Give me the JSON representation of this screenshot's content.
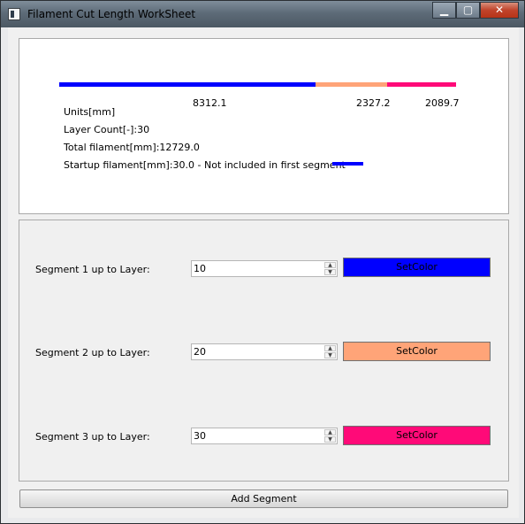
{
  "window": {
    "title": "Filament Cut Length WorkSheet",
    "caption_buttons": {
      "minimize": "▁",
      "maximize": "▢",
      "close": "✕"
    }
  },
  "colors": {
    "segment1": "#0000ff",
    "segment2": "#ffa478",
    "segment3": "#ff0a78",
    "startup": "#0000ff"
  },
  "summary": {
    "segments": [
      {
        "length": "8312.1"
      },
      {
        "length": "2327.2"
      },
      {
        "length": "2089.7"
      }
    ],
    "units": "Units[mm]",
    "layer_count": "Layer Count[-]:30",
    "total_filament": "Total filament[mm]:12729.0",
    "startup_filament": "Startup filament[mm]:30.0 - Not included in first segment"
  },
  "segments": [
    {
      "label": "Segment 1 up to Layer:",
      "value": "10",
      "button": "SetColor"
    },
    {
      "label": "Segment 2 up to Layer:",
      "value": "20",
      "button": "SetColor"
    },
    {
      "label": "Segment 3 up to Layer:",
      "value": "30",
      "button": "SetColor"
    }
  ],
  "add_segment_label": "Add Segment"
}
